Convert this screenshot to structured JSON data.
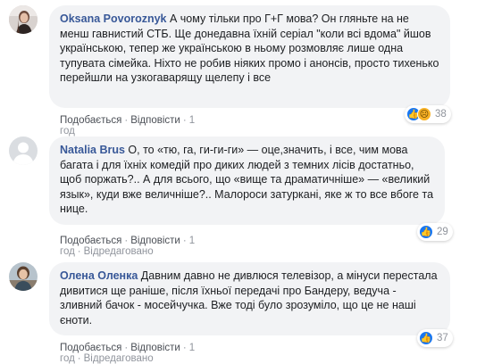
{
  "comments": [
    {
      "author": "Oksana Povoroznyk",
      "text": "А чому тільки про Г+Г мова? Он гляньте на не менш гавнистий СТБ. Ще донедавна їхній серіал \"коли всі вдома\" йшов українською, тепер же українською в ньому розмовляє лише одна тупувата сімейка. Ніхто не робив ніяких промо і анонсів, просто тихенько перейшли на узкогаварящу щелепу і все",
      "like_label": "Подобається",
      "reply_label": "Відповісти",
      "time": "1 год",
      "edited": "",
      "reaction_count": "38",
      "reactions": [
        "like-icon",
        "sad-icon"
      ]
    },
    {
      "author": "Natalia Brus",
      "text": "О, то «тю, га, ги-ги-ги» — оце,значить, і все, чим мова багата і для їхніх комедій про диких людей з темних лісів достатньо, щоб поржать?.. А для всього, що «вище та драматичніше» — «великий язык», куди вже величніше?.. Малороси затуркані, яке ж то все вбоге та нице.",
      "like_label": "Подобається",
      "reply_label": "Відповісти",
      "time": "1 год",
      "edited": "Відредаговано",
      "reaction_count": "29",
      "reactions": [
        "like-icon"
      ]
    },
    {
      "author": "Олена Оленка",
      "text": "Давним давно не дивлюся телевізор, а мінуси перестала дивитися ще раніше, після їхньої передачі про Бандеру, ведуча - зливний бачок - мосейчучка. Вже тоді було зрозуміло, що це не наші єноти.",
      "like_label": "Подобається",
      "reply_label": "Відповісти",
      "time": "1 год",
      "edited": "Відредаговано",
      "reaction_count": "37",
      "reactions": [
        "like-icon"
      ]
    }
  ],
  "separator": "·",
  "colors": {
    "author": "#385898",
    "bubble": "#f2f3f5",
    "like": "#1877f2",
    "sad": "#f7b125"
  }
}
